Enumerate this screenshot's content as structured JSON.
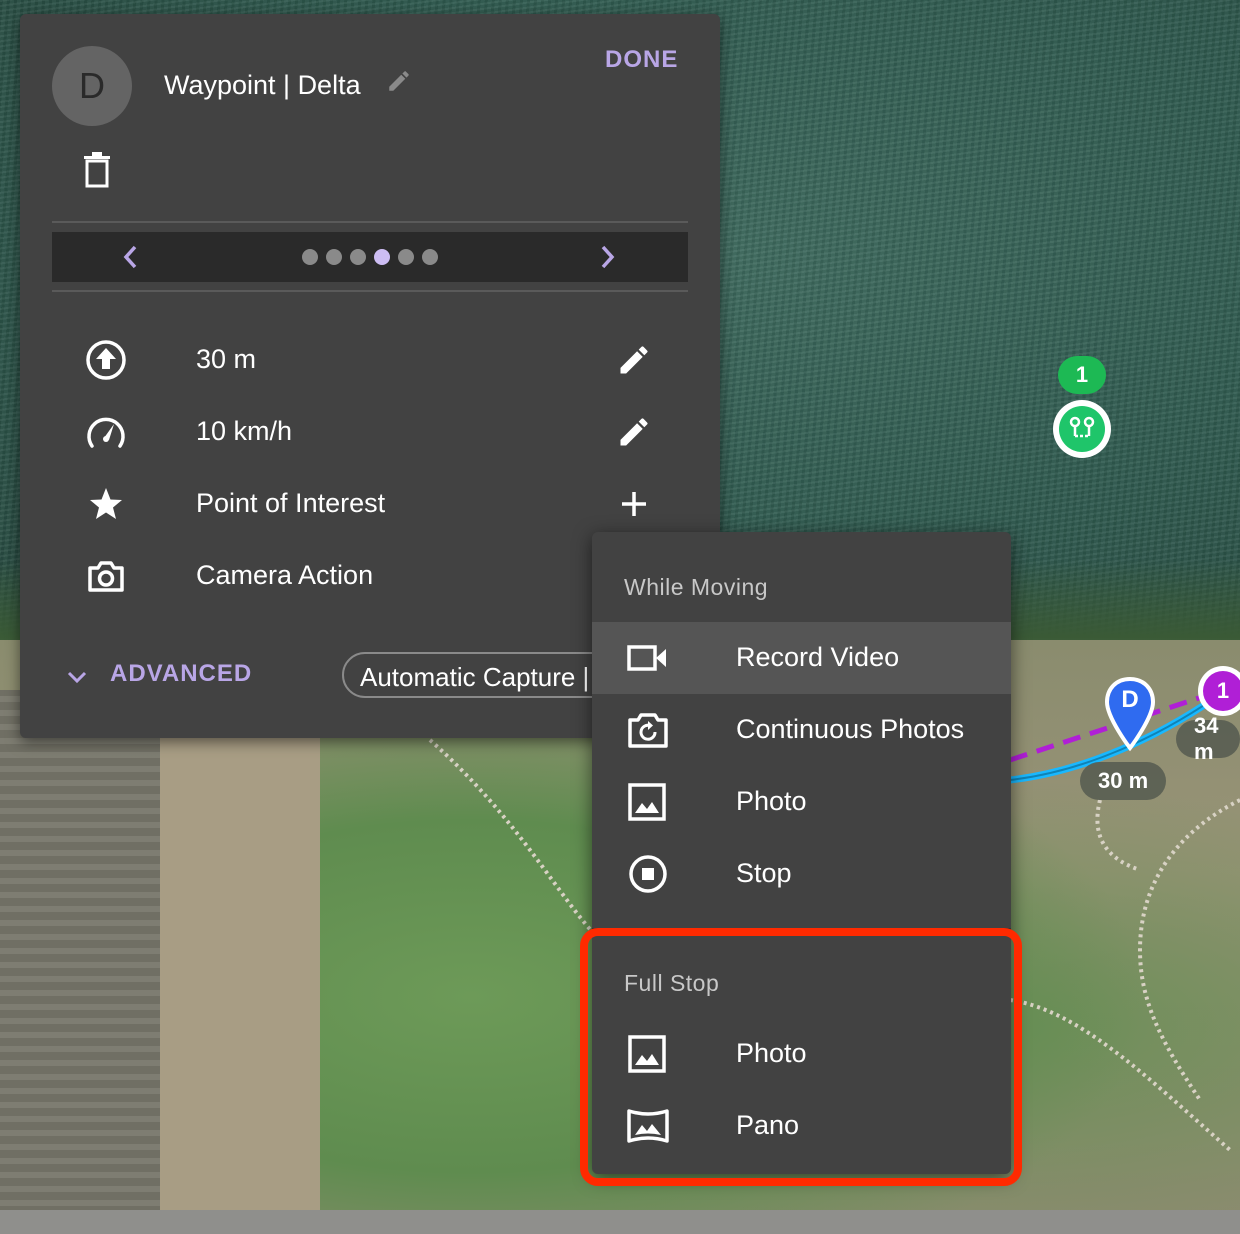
{
  "panel": {
    "avatar_letter": "D",
    "title": "Waypoint | Delta",
    "done_label": "DONE",
    "settings": [
      {
        "value": "30 m",
        "icon": "altitude-up-icon",
        "action_icon": "pencil-icon"
      },
      {
        "value": "10 km/h",
        "icon": "speedometer-icon",
        "action_icon": "pencil-icon"
      },
      {
        "value": "Point of Interest",
        "icon": "star-icon",
        "action_icon": "plus-icon"
      },
      {
        "value": "Camera Action",
        "icon": "camera-icon",
        "action_icon": ""
      }
    ],
    "pager": {
      "page_count": 6,
      "active_index": 3
    },
    "advanced_label": "ADVANCED",
    "capture_value": "Automatic Capture |"
  },
  "menu": {
    "while_moving": {
      "header": "While Moving",
      "items": [
        {
          "label": "Record Video",
          "icon": "video-camera-icon"
        },
        {
          "label": "Continuous Photos",
          "icon": "continuous-photos-icon"
        },
        {
          "label": "Photo",
          "icon": "photo-icon"
        },
        {
          "label": "Stop",
          "icon": "stop-icon"
        }
      ]
    },
    "full_stop": {
      "header": "Full Stop",
      "items": [
        {
          "label": "Photo",
          "icon": "photo-icon"
        },
        {
          "label": "Pano",
          "icon": "panorama-icon"
        }
      ]
    }
  },
  "map": {
    "badge_green": "1",
    "distance_1": "30 m",
    "distance_2": "34 m",
    "pin_d": "D",
    "pin_1": "1"
  },
  "colors": {
    "accent": "#b9a6e6",
    "highlight": "#ff2a00",
    "route_blue": "#19b8ff",
    "route_purple": "#b01fd6",
    "waypoint_green": "#1fc56a",
    "pin_blue": "#2f6bf0"
  }
}
